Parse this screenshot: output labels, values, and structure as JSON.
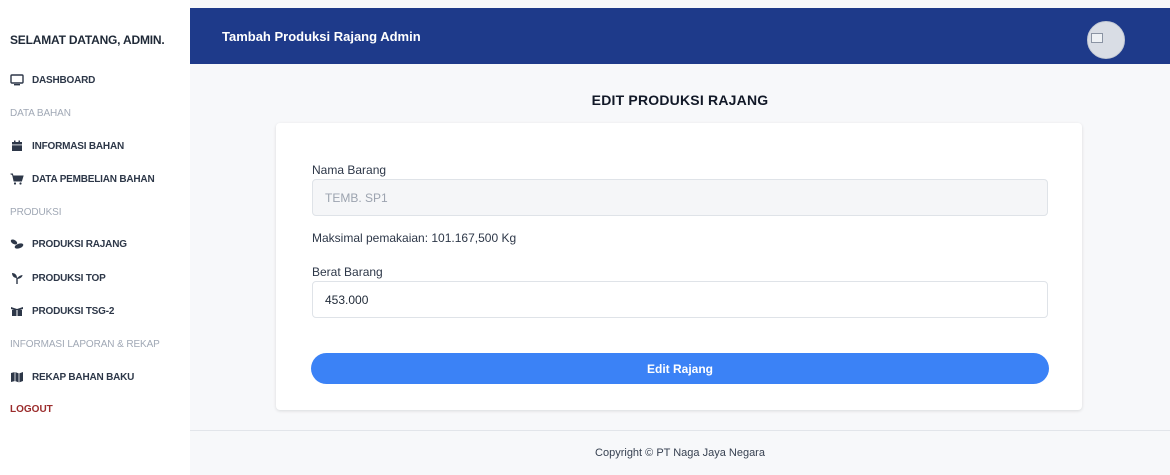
{
  "sidebar": {
    "greeting": "SELAMAT DATANG, ADMIN.",
    "dashboard": {
      "label": "DASHBOARD",
      "icon": "monitor-icon"
    },
    "heading_data_bahan": "DATA BAHAN",
    "informasi_bahan": {
      "label": "INFORMASI BAHAN",
      "icon": "calendar-icon"
    },
    "data_pembelian": {
      "label": "DATA PEMBELIAN BAHAN",
      "icon": "cart-icon"
    },
    "heading_produksi": "PRODUKSI",
    "produksi_rajang": {
      "label": "PRODUKSI RAJANG",
      "icon": "leaves-icon"
    },
    "produksi_top": {
      "label": "PRODUKSI TOP",
      "icon": "seedling-icon"
    },
    "produksi_tsg": {
      "label": "PRODUKSI TSG-2",
      "icon": "box-open-icon"
    },
    "heading_laporan": "INFORMASI LAPORAN & REKAP",
    "rekap_bahan": {
      "label": "REKAP BAHAN BAKU",
      "icon": "map-icon"
    },
    "logout": "LOGOUT"
  },
  "topbar": {
    "title": "Tambah Produksi Rajang Admin",
    "avatar": "avatar-image"
  },
  "main": {
    "page_title": "EDIT PRODUKSI RAJANG",
    "form": {
      "nama_barang_label": "Nama Barang",
      "nama_barang_value": "TEMB. SP1",
      "info_text": "Maksimal pemakaian: 101.167,500 Kg",
      "berat_barang_label": "Berat Barang",
      "berat_barang_value": "453.000",
      "submit_label": "Edit Rajang"
    }
  },
  "footer": {
    "copyright": "Copyright © PT Naga Jaya Negara"
  },
  "colors": {
    "topbar": "#1e3a8a",
    "button": "#3b82f6",
    "logout": "#9b2c2c"
  }
}
